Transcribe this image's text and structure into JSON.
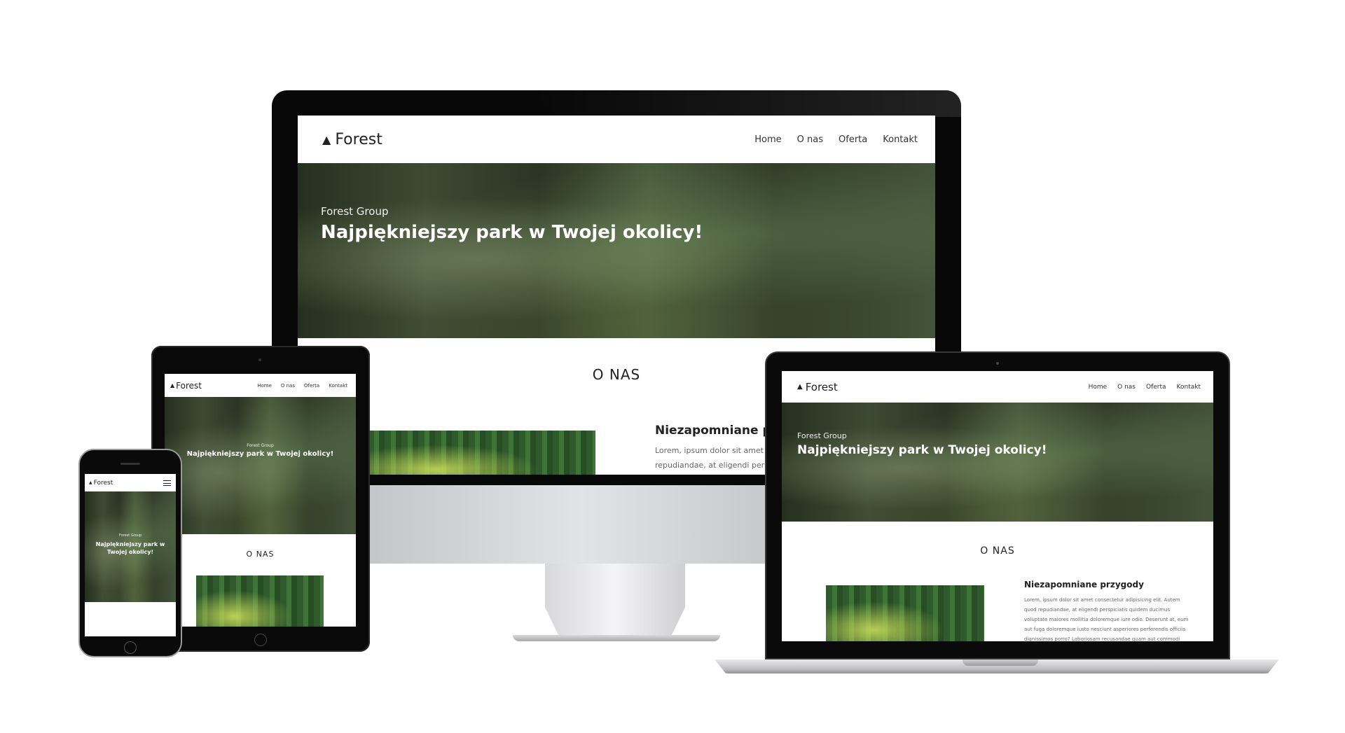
{
  "brand": {
    "name": "Forest",
    "icon": "tree-icon"
  },
  "nav": {
    "items": [
      "Home",
      "O nas",
      "Oferta",
      "Kontakt"
    ],
    "mobile_icon": "hamburger-icon"
  },
  "hero": {
    "subtitle": "Forest Group",
    "title": "Najpiękniejszy park w Twojej okolicy!"
  },
  "about": {
    "heading": "O NAS",
    "card_title_desktop": "Niezapomniane prz",
    "card_title": "Niezapomniane przygody",
    "desktop_text_line1": "Lorem, ipsum dolor sit amet cons",
    "desktop_text_line2": "repudiandae, at eligendi perspicia",
    "laptop_text": "Lorem, ipsum dolor sit amet consectetur adipisicing elit. Autem quod repudiandae, at eligendi perspiciatis quidem ducimus voluptate maiores mollitia doloremque iure odio. Deserunt at, eum aut fuga doloremque iusto nesciunt asperiores perferendis officiis dignissimos porro? Laboriosam recusandae quam aut commodi"
  },
  "colors": {
    "device_black": "#0b0b0b",
    "silver": "#cfcfd1",
    "text_dark": "#222222",
    "hero_text": "#ffffff"
  }
}
